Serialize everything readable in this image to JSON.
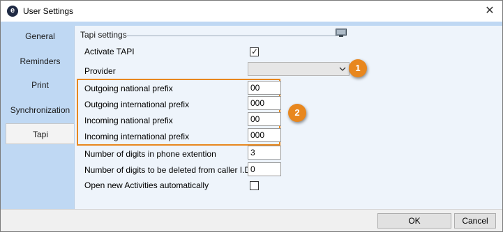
{
  "window": {
    "title": "User Settings",
    "app_icon_letter": "e",
    "close_glyph": "✕"
  },
  "tabs": [
    {
      "label": "General",
      "active": false
    },
    {
      "label": "Reminders",
      "active": false
    },
    {
      "label": "Print",
      "active": false
    },
    {
      "label": "Synchronization",
      "active": false
    },
    {
      "label": "Tapi",
      "active": true
    }
  ],
  "tapi": {
    "group_title": "Tapi settings",
    "group_icon": "monitor-icon",
    "activate_label": "Activate TAPI",
    "activate_checked": true,
    "provider_label": "Provider",
    "provider_value": "",
    "outgoing_national_label": "Outgoing national prefix",
    "outgoing_national_value": "00",
    "outgoing_international_label": "Outgoing international prefix",
    "outgoing_international_value": "000",
    "incoming_national_label": "Incoming national prefix",
    "incoming_national_value": "00",
    "incoming_international_label": "Incoming international prefix",
    "incoming_international_value": "000",
    "digits_extension_label": "Number of digits in phone extention",
    "digits_extension_value": "3",
    "digits_delete_label": "Number of digits to be deleted from caller I.D.",
    "digits_delete_value": "0",
    "open_activities_label": "Open new Activities automatically",
    "open_activities_checked": false
  },
  "callouts": {
    "badge_1": "1",
    "badge_2": "2",
    "accent_color": "#e8871e"
  },
  "footer": {
    "ok_label": "OK",
    "cancel_label": "Cancel"
  }
}
